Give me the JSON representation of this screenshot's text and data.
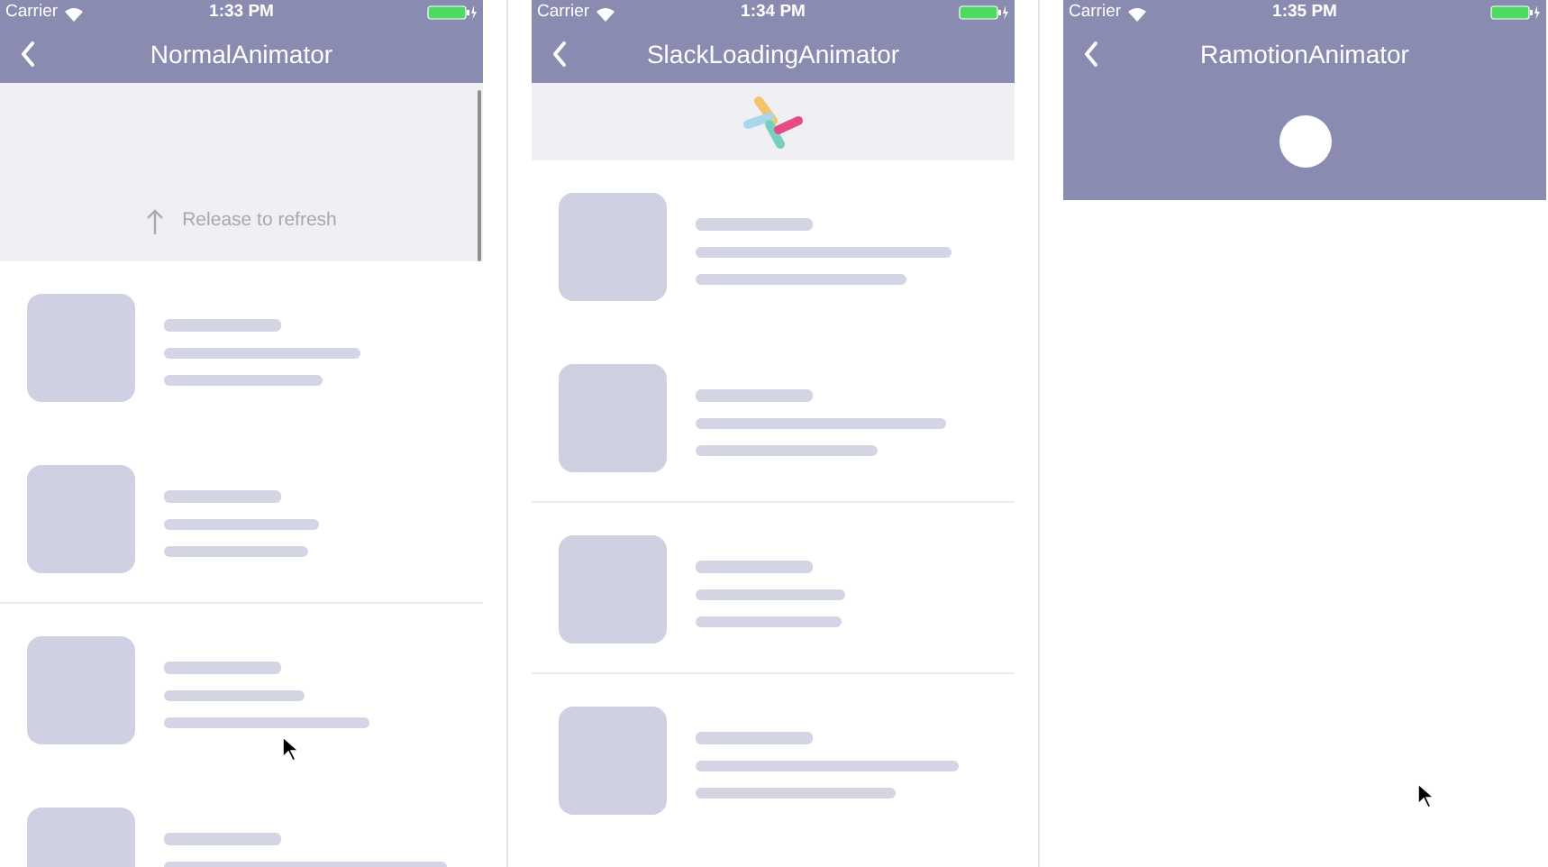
{
  "screens": [
    {
      "status_bar": {
        "carrier": "Carrier",
        "time": "1:33 PM"
      },
      "title": "NormalAnimator",
      "header": {
        "kind": "refresh_text",
        "text": "Release to refresh"
      },
      "rows": [
        {
          "kind": "skeleton",
          "divider_below": false
        },
        {
          "kind": "skeleton",
          "divider_below": true
        },
        {
          "kind": "skeleton",
          "divider_below": false
        },
        {
          "kind": "skeleton"
        }
      ]
    },
    {
      "status_bar": {
        "carrier": "Carrier",
        "time": "1:34 PM"
      },
      "title": "SlackLoadingAnimator",
      "header": {
        "kind": "slack_loader"
      },
      "rows": [
        {
          "kind": "skeleton",
          "divider_below": false
        },
        {
          "kind": "skeleton",
          "divider_below": true
        },
        {
          "kind": "skeleton",
          "divider_below": true
        },
        {
          "kind": "skeleton",
          "divider_below": false
        }
      ]
    },
    {
      "status_bar": {
        "carrier": "Carrier",
        "time": "1:35 PM"
      },
      "title": "RamotionAnimator",
      "header": {
        "kind": "ramotion_ball"
      }
    }
  ]
}
